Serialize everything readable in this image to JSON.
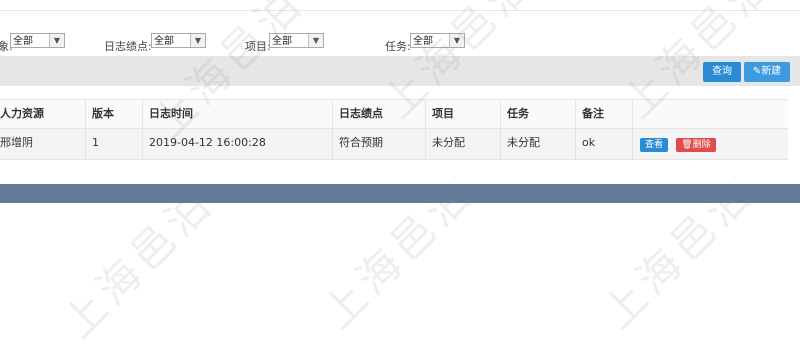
{
  "filters": {
    "f0": {
      "label": "象:",
      "value": "全部"
    },
    "f1": {
      "label": "日志绩点:",
      "value": "全部"
    },
    "f2": {
      "label": "项目:",
      "value": "全部"
    },
    "f3": {
      "label": "任务:",
      "value": "全部"
    }
  },
  "toolbar": {
    "query_label": "查询",
    "new_label": "新建"
  },
  "table": {
    "headers": [
      "人力资源",
      "版本",
      "日志时间",
      "日志绩点",
      "项目",
      "任务",
      "备注",
      ""
    ],
    "rows": [
      {
        "cells": [
          "邢增阴",
          "1",
          "2019-04-12 16:00:28",
          "符合预期",
          "未分配",
          "未分配",
          "ok"
        ],
        "view_label": "查看",
        "delete_label": "删除"
      }
    ]
  },
  "watermark": "上海邑泊"
}
